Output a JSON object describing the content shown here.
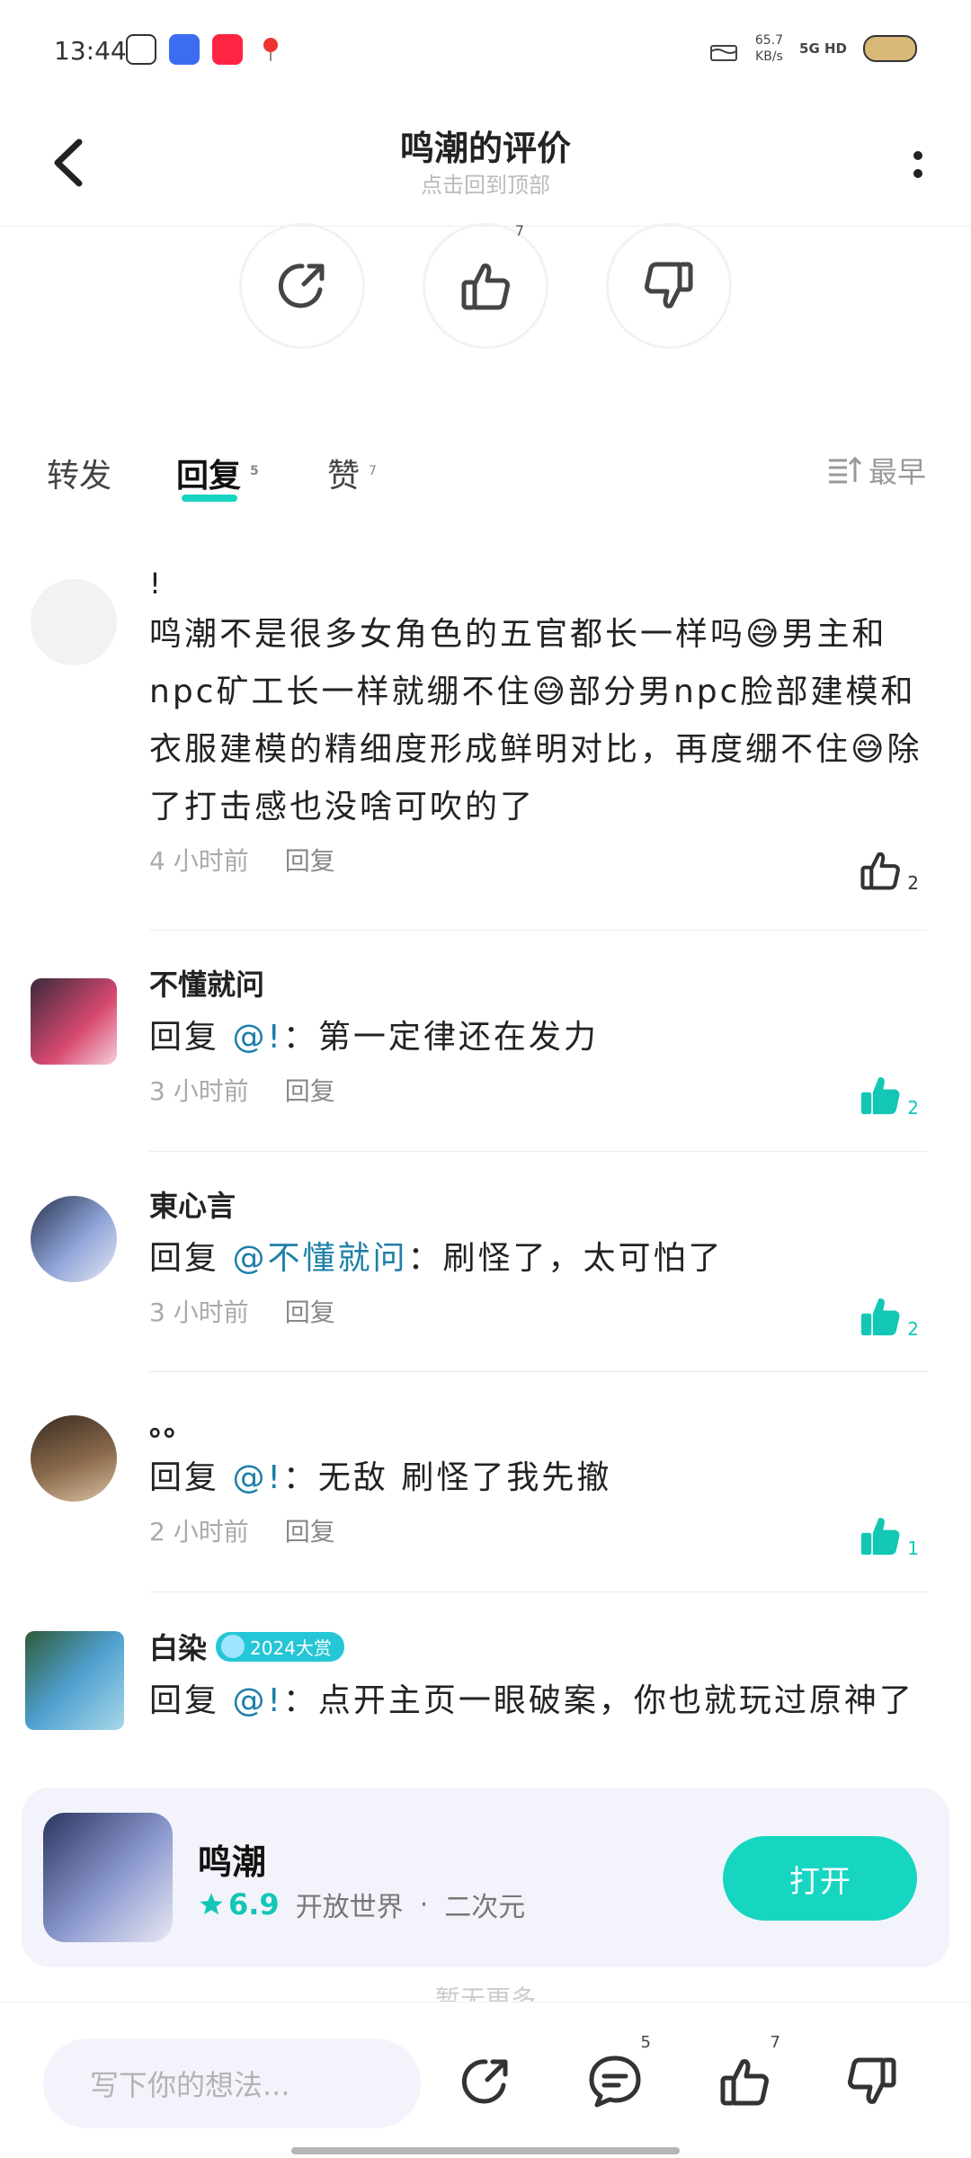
{
  "status_bar": {
    "time": "13:44",
    "speed_value": "65.7",
    "speed_unit": "KB/s",
    "network": "5G HD"
  },
  "header": {
    "title": "鸣潮的评价",
    "subtitle": "点击回到顶部"
  },
  "actions": {
    "like_count": "7"
  },
  "tabs": [
    {
      "label": "转发",
      "count": ""
    },
    {
      "label": "回复",
      "count": "5"
    },
    {
      "label": "赞",
      "count": "7"
    }
  ],
  "sort_label": "最早",
  "comments": [
    {
      "username": "!",
      "text": "鸣潮不是很多女角色的五官都长一样吗😅男主和npc矿工长一样就绷不住😅部分男npc脸部建模和衣服建模的精细度形成鲜明对比，再度绷不住😅除了打击感也没啥可吹的了",
      "time": "4 小时前",
      "reply_label": "回复",
      "likes": "2",
      "liked": false
    },
    {
      "username": "不懂就问",
      "reply_prefix": "回复 ",
      "mention": "@!",
      "text": "：第一定律还在发力",
      "time": "3 小时前",
      "reply_label": "回复",
      "likes": "2",
      "liked": true
    },
    {
      "username": "東心言",
      "reply_prefix": "回复 ",
      "mention": "@不懂就问",
      "text": "：刷怪了，太可怕了",
      "time": "3 小时前",
      "reply_label": "回复",
      "likes": "2",
      "liked": true
    },
    {
      "username": "。。",
      "reply_prefix": "回复 ",
      "mention": "@!",
      "text": "：无敌 刷怪了我先撤",
      "time": "2 小时前",
      "reply_label": "回复",
      "likes": "1",
      "liked": true
    },
    {
      "username": "白染",
      "badge": "2024大赏",
      "reply_prefix": "回复 ",
      "mention": "@!",
      "text": "：点开主页一眼破案，你也就玩过原神了"
    }
  ],
  "game": {
    "name": "鸣潮",
    "rating": "6.9",
    "genre1": "开放世界",
    "separator": "·",
    "genre2": "二次元",
    "button": "打开"
  },
  "faint_text": "暂无更多",
  "bottom_bar": {
    "placeholder": "写下你的想法...",
    "comment_count": "5",
    "like_count": "7"
  },
  "colors": {
    "accent": "#16d6c2",
    "mention": "#1e7fa8"
  }
}
